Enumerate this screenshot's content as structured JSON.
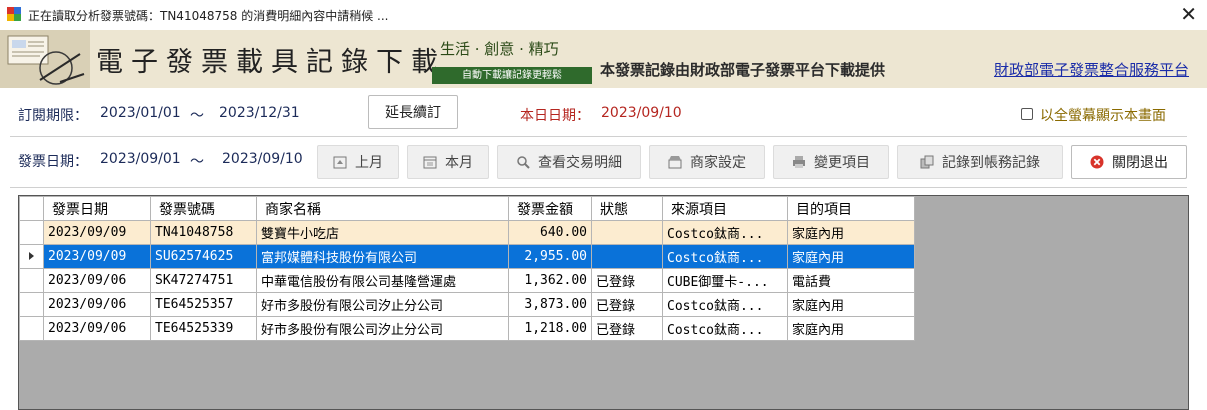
{
  "window": {
    "title": "正在讀取分析發票號碼：TN41048758 的消費明細內容中請稍候 ...",
    "close_label": "✕"
  },
  "banner": {
    "brand": "電子發票載具記錄下載",
    "slogan": "生活 · 創意 · 精巧",
    "tagline": "自動下載讓記錄更輕鬆",
    "provider": "本發票記錄由財政部電子發票平台下載提供",
    "portal_link": "財政部電子發票整合服務平台"
  },
  "subscription": {
    "label": "訂閱期限：",
    "start": "2023/01/01",
    "tilde": "～",
    "end": "2023/12/31",
    "extend_button": "延長續訂",
    "today_label": "本日日期：",
    "today_value": "2023/09/10",
    "fullscreen_label": "以全螢幕顯示本畫面"
  },
  "filter": {
    "label": "發票日期：",
    "start": "2023/09/01",
    "tilde": "～",
    "end": "2023/09/10"
  },
  "toolbar": {
    "prev_month": "上月",
    "this_month": "本月",
    "query_detail": "查看交易明細",
    "merchant_settings": "商家設定",
    "change_item": "變更項目",
    "record_to_ledger": "記錄到帳務記錄",
    "close_exit": "關閉退出"
  },
  "grid": {
    "columns": [
      "發票日期",
      "發票號碼",
      "商家名稱",
      "發票金額",
      "狀態",
      "來源項目",
      "目的項目"
    ],
    "rows": [
      [
        "2023/09/09",
        "TN41048758",
        "雙寶牛小吃店",
        "640.00",
        "",
        "Costco鈦商...",
        "家庭內用"
      ],
      [
        "2023/09/09",
        "SU62574625",
        "富邦媒體科技股份有限公司",
        "2,955.00",
        "",
        "Costco鈦商...",
        "家庭內用"
      ],
      [
        "2023/09/06",
        "SK47274751",
        "中華電信股份有限公司基隆營運處",
        "1,362.00",
        "已登錄",
        "CUBE御璽卡-...",
        "電話費"
      ],
      [
        "2023/09/06",
        "TE64525357",
        "好市多股份有限公司汐止分公司",
        "3,873.00",
        "已登錄",
        "Costco鈦商...",
        "家庭內用"
      ],
      [
        "2023/09/06",
        "TE64525339",
        "好市多股份有限公司汐止分公司",
        "1,218.00",
        "已登錄",
        "Costco鈦商...",
        "家庭內用"
      ]
    ],
    "highlighted_row": 0,
    "selected_row": 1
  },
  "colors": {
    "selection": "#0a72d9",
    "highlight": "#fcecd0",
    "accent_red": "#b52620",
    "navy": "#1c2b59",
    "banner_bg": "#ede6d2",
    "tag_green": "#2f6a2c"
  }
}
